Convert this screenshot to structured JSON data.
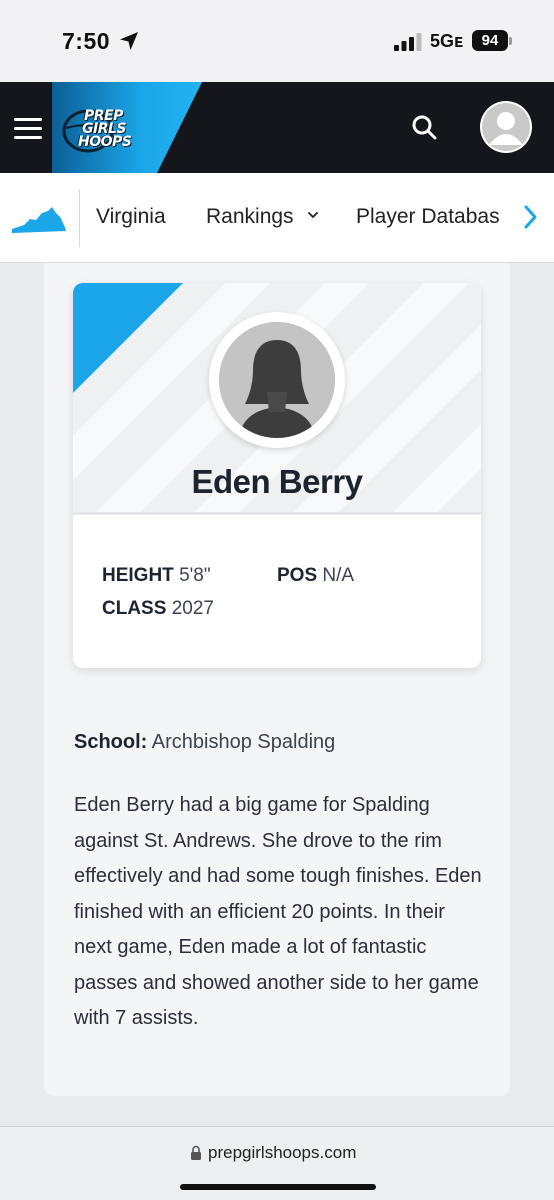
{
  "status_bar": {
    "time": "7:50",
    "network": "5Gᴇ",
    "battery": "94"
  },
  "header": {
    "logo_line1": "PREP",
    "logo_line2": "GIRLS",
    "logo_line3": "HOOPS"
  },
  "subnav": {
    "items": [
      {
        "label": "Virginia"
      },
      {
        "label": "Rankings"
      },
      {
        "label": "Player Databas"
      }
    ]
  },
  "profile": {
    "name": "Eden Berry",
    "height_label": "HEIGHT",
    "height_value": "5'8\"",
    "pos_label": "POS",
    "pos_value": "N/A",
    "class_label": "CLASS",
    "class_value": "2027"
  },
  "school": {
    "label": "School:",
    "value": "Archbishop Spalding"
  },
  "bio": "Eden Berry had a big game for Spalding against St. Andrews. She drove to the rim effectively and had some tough finishes. Eden finished with an efficient 20 points. In their next game, Eden made a lot of fantastic passes and showed another side to her game with 7 assists.",
  "browser": {
    "url": "prepgirlshoops.com"
  },
  "colors": {
    "accent": "#1aa6e8",
    "header_bg": "#15161b"
  }
}
